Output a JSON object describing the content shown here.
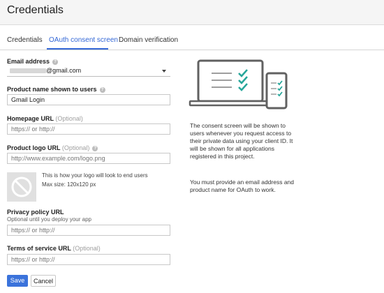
{
  "header": {
    "title": "Credentials"
  },
  "tabs": [
    {
      "label": "Credentials"
    },
    {
      "label": "OAuth consent screen",
      "active": true
    },
    {
      "label": "Domain verification"
    }
  ],
  "form": {
    "email": {
      "label": "Email address",
      "value_suffix": "@gmail.com"
    },
    "product_name": {
      "label": "Product name shown to users",
      "value": "Gmail Login"
    },
    "homepage": {
      "label": "Homepage URL",
      "optional": "(Optional)",
      "placeholder": "https:// or http://"
    },
    "logo_url": {
      "label": "Product logo URL",
      "optional": "(Optional)",
      "placeholder": "http://www.example.com/logo.png"
    },
    "logo_note": {
      "line1": "This is how your logo will look to end users",
      "line2": "Max size: 120x120 px"
    },
    "privacy": {
      "label": "Privacy policy URL",
      "sublabel": "Optional until you deploy your app",
      "placeholder": "https:// or http://"
    },
    "tos": {
      "label": "Terms of service URL",
      "optional": "(Optional)",
      "placeholder": "https:// or http://"
    }
  },
  "buttons": {
    "save": "Save",
    "cancel": "Cancel"
  },
  "info": {
    "p1": "The consent screen will be shown to users whenever you request access to their private data using your client ID. It will be shown for all applications registered in this project.",
    "p2": "You must provide an email address and product name for OAuth to work."
  },
  "colors": {
    "accent": "#3367d6",
    "save_button": "#3b73db",
    "illustration_check": "#26a69a",
    "illustration_frame": "#616161"
  },
  "icons": [
    "help-icon",
    "dropdown-caret-icon",
    "no-image-icon",
    "laptop-checklist-icon",
    "phone-checklist-icon"
  ]
}
